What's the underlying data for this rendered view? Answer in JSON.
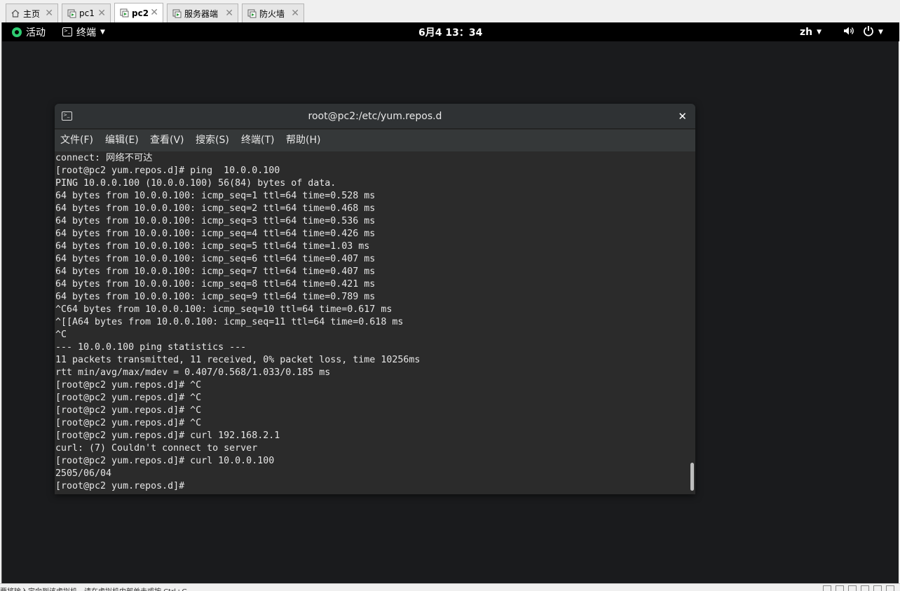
{
  "vm_tabs": [
    {
      "label": "主页",
      "icon": "home-icon"
    },
    {
      "label": "pc1",
      "icon": "vm-icon"
    },
    {
      "label": "pc2",
      "icon": "vm-icon",
      "active": true
    },
    {
      "label": "服务器端",
      "icon": "vm-icon"
    },
    {
      "label": "防火墙",
      "icon": "vm-icon"
    }
  ],
  "topbar": {
    "activities": "活动",
    "app_menu": "终端",
    "clock": "6月4 13：34",
    "language": "zh"
  },
  "terminal": {
    "title": "root@pc2:/etc/yum.repos.d",
    "menu": [
      "文件(F)",
      "编辑(E)",
      "查看(V)",
      "搜索(S)",
      "终端(T)",
      "帮助(H)"
    ],
    "lines": [
      "connect: 网络不可达",
      "[root@pc2 yum.repos.d]# ping  10.0.0.100",
      "PING 10.0.0.100 (10.0.0.100) 56(84) bytes of data.",
      "64 bytes from 10.0.0.100: icmp_seq=1 ttl=64 time=0.528 ms",
      "64 bytes from 10.0.0.100: icmp_seq=2 ttl=64 time=0.468 ms",
      "64 bytes from 10.0.0.100: icmp_seq=3 ttl=64 time=0.536 ms",
      "64 bytes from 10.0.0.100: icmp_seq=4 ttl=64 time=0.426 ms",
      "64 bytes from 10.0.0.100: icmp_seq=5 ttl=64 time=1.03 ms",
      "64 bytes from 10.0.0.100: icmp_seq=6 ttl=64 time=0.407 ms",
      "64 bytes from 10.0.0.100: icmp_seq=7 ttl=64 time=0.407 ms",
      "64 bytes from 10.0.0.100: icmp_seq=8 ttl=64 time=0.421 ms",
      "64 bytes from 10.0.0.100: icmp_seq=9 ttl=64 time=0.789 ms",
      "^C64 bytes from 10.0.0.100: icmp_seq=10 ttl=64 time=0.617 ms",
      "^[[A64 bytes from 10.0.0.100: icmp_seq=11 ttl=64 time=0.618 ms",
      "^C",
      "--- 10.0.0.100 ping statistics ---",
      "11 packets transmitted, 11 received, 0% packet loss, time 10256ms",
      "rtt min/avg/max/mdev = 0.407/0.568/1.033/0.185 ms",
      "[root@pc2 yum.repos.d]# ^C",
      "[root@pc2 yum.repos.d]# ^C",
      "[root@pc2 yum.repos.d]# ^C",
      "[root@pc2 yum.repos.d]# ^C",
      "[root@pc2 yum.repos.d]# curl 192.168.2.1",
      "curl: (7) Couldn't connect to server",
      "[root@pc2 yum.repos.d]# curl 10.0.0.100",
      "2505/06/04",
      "[root@pc2 yum.repos.d]# "
    ]
  },
  "statusbar": {
    "hint": "要将输入定向到该虚拟机，请在虚拟机内部单击或按 Ctrl+G。"
  },
  "colors": {
    "activities_accent": "#2ecc71",
    "terminal_bg": "#2b2b2b",
    "desktop_bg": "#1a1b1d"
  }
}
